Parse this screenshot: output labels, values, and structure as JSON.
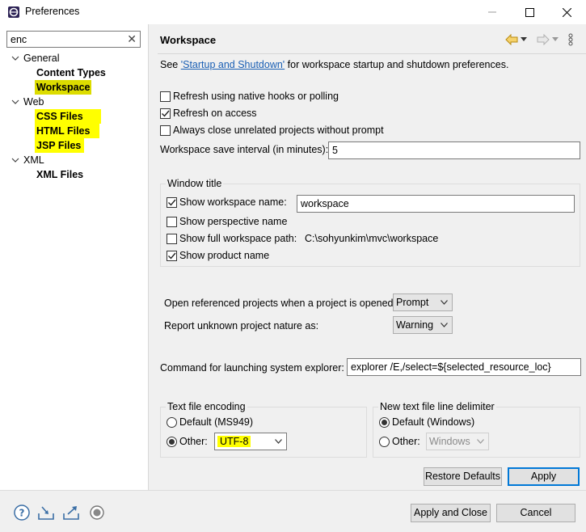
{
  "window": {
    "title": "Preferences",
    "minimize_icon": "minimize-icon",
    "maximize_icon": "maximize-icon",
    "close_icon": "close-icon"
  },
  "filter": {
    "value": "enc"
  },
  "tree": {
    "general": "General",
    "content_types": "Content Types",
    "workspace": "Workspace",
    "web": "Web",
    "css_files": "CSS Files",
    "html_files": "HTML Files",
    "jsp_files": "JSP Files",
    "xml": "XML",
    "xml_files": "XML Files"
  },
  "page": {
    "title": "Workspace",
    "see_prefix": "See ",
    "see_link": "'Startup and Shutdown'",
    "see_suffix": " for workspace startup and shutdown preferences.",
    "refresh_native": "Refresh using native hooks or polling",
    "refresh_on_access": "Refresh on access",
    "always_close": "Always close unrelated projects without prompt",
    "save_interval_label": "Workspace save interval (in minutes):",
    "save_interval_value": "5",
    "window_title_group": "Window title",
    "show_workspace_name": "Show workspace name:",
    "workspace_name_value": "workspace",
    "show_perspective_name": "Show perspective name",
    "show_full_path": "Show full workspace path:",
    "full_path_value": "C:\\sohyunkim\\mvc\\workspace",
    "show_product_name": "Show product name",
    "open_referenced_label": "Open referenced projects when a project is opened:",
    "open_referenced_value": "Prompt",
    "report_unknown_label": "Report unknown project nature as:",
    "report_unknown_value": "Warning",
    "command_label": "Command for launching system explorer:",
    "command_value": "explorer /E,/select=${selected_resource_loc}",
    "encoding_group": "Text file encoding",
    "encoding_default": "Default (MS949)",
    "encoding_other": "Other:",
    "encoding_other_value": "UTF-8",
    "delimiter_group": "New text file line delimiter",
    "delimiter_default": "Default (Windows)",
    "delimiter_other": "Other:",
    "delimiter_other_value": "Windows"
  },
  "buttons": {
    "restore_defaults": "Restore Defaults",
    "apply": "Apply",
    "apply_and_close": "Apply and Close",
    "cancel": "Cancel"
  },
  "states": {
    "refresh_native": false,
    "refresh_on_access": true,
    "always_close": false,
    "show_workspace_name": true,
    "show_perspective_name": false,
    "show_full_path": false,
    "show_product_name": true,
    "encoding": "other",
    "delimiter": "default"
  },
  "colors": {
    "highlight": "#ffff00",
    "link": "#1a5fb4",
    "focus": "#0078d7"
  },
  "icons": [
    "help-icon",
    "import-icon",
    "export-icon",
    "oomph-icon",
    "back-icon",
    "forward-icon",
    "view-menu-icon"
  ]
}
